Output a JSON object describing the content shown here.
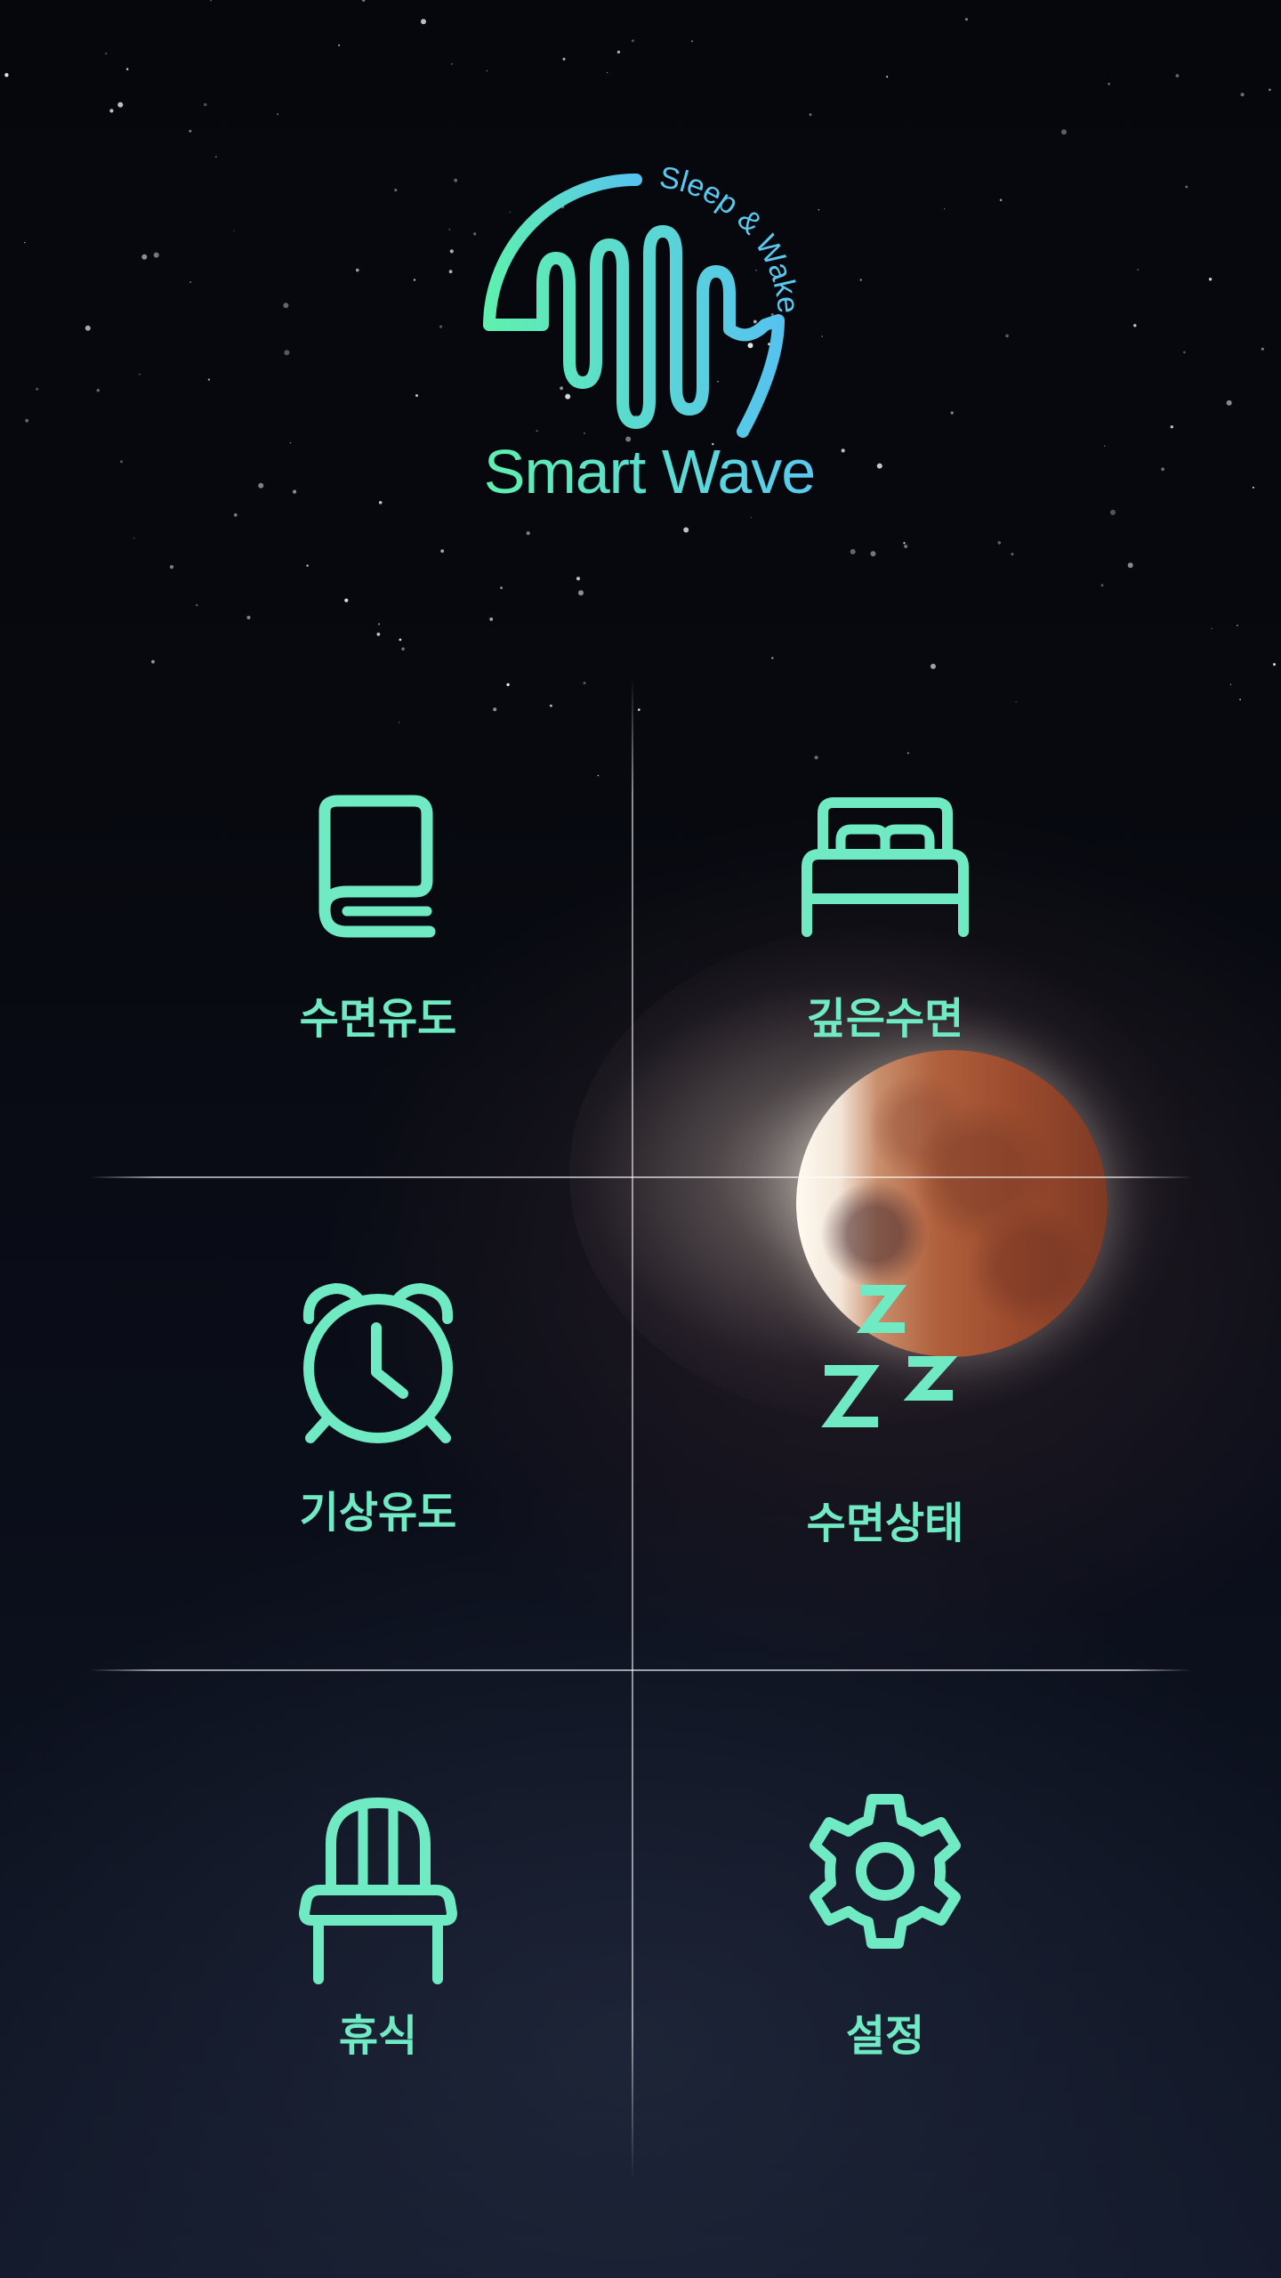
{
  "logo": {
    "arc_text": "Sleep & Wake",
    "title": "Smart Wave"
  },
  "colors": {
    "accent": "#6feac3",
    "accent_blue": "#59c9f0",
    "background": "#06080f"
  },
  "menu": {
    "items": [
      {
        "label": "수면유도",
        "icon": "book-icon"
      },
      {
        "label": "깊은수면",
        "icon": "bed-icon"
      },
      {
        "label": "기상유도",
        "icon": "alarm-clock-icon"
      },
      {
        "label": "수면상태",
        "icon": "zzz-icon"
      },
      {
        "label": "휴식",
        "icon": "chair-icon"
      },
      {
        "label": "설정",
        "icon": "gear-icon"
      }
    ]
  }
}
